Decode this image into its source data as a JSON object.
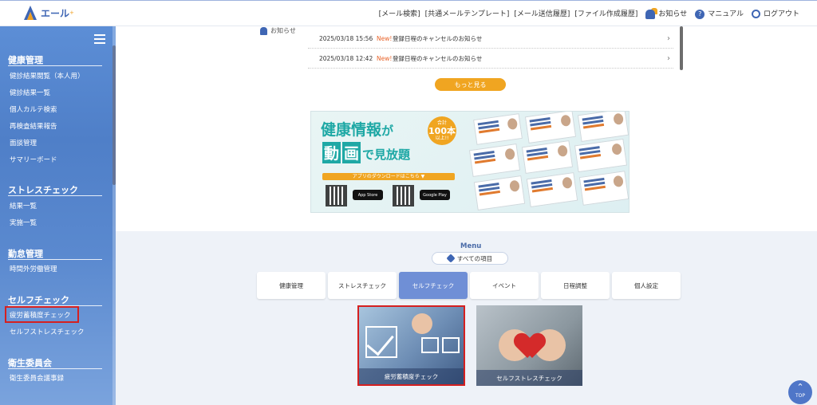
{
  "header": {
    "app_name": "エール",
    "app_sup": "+",
    "nav": [
      "[メール検索]",
      "[共通メールテンプレート]",
      "[メール送信履歴]",
      "[ファイル作成履歴]"
    ],
    "notice": "お知らせ",
    "manual": "マニュアル",
    "logout": "ログアウト"
  },
  "sidebar": {
    "sections": [
      {
        "title": "健康管理",
        "items": [
          "健診結果閲覧（本人用）",
          "健診結果一覧",
          "個人カルテ検索",
          "再検査結果報告",
          "面談管理",
          "サマリーボード"
        ]
      },
      {
        "title": "ストレスチェック",
        "items": [
          "結果一覧",
          "実施一覧"
        ]
      },
      {
        "title": "勤怠管理",
        "items": [
          "時間外労働管理"
        ]
      },
      {
        "title": "セルフチェック",
        "items": [
          "疲労蓄積度チェック",
          "セルフストレスチェック"
        ]
      },
      {
        "title": "衛生委員会",
        "items": [
          "衛生委員会議事録"
        ]
      }
    ]
  },
  "notices": {
    "label": "お知らせ",
    "rows": [
      {
        "date": "2025/03/18 15:56",
        "new": "New!",
        "title": "登録日程のキャンセルのお知らせ"
      },
      {
        "date": "2025/03/18 12:42",
        "new": "New!",
        "title": "登録日程のキャンセルのお知らせ"
      }
    ],
    "more": "もっと見る"
  },
  "banner": {
    "line1": "健康情報",
    "line1_ga": "が",
    "line2_a": "動",
    "line2_b": "画",
    "line2_c": "で見放題",
    "badge_top": "合計",
    "badge_num": "100本",
    "badge_bottom": "以上!!",
    "download": "アプリのダウンロードはこちら ▼",
    "app_store": "App Store",
    "google_play": "Google Play"
  },
  "menu": {
    "title": "Menu",
    "all_items": "すべての項目",
    "tabs": [
      "健康管理",
      "ストレスチェック",
      "セルフチェック",
      "イベント",
      "日程調整",
      "個人設定"
    ],
    "active_tab": "セルフチェック",
    "cards": [
      "疲労蓄積度チェック",
      "セルフストレスチェック"
    ]
  },
  "top_button": "TOP",
  "colors": {
    "accent": "#3f66b4",
    "highlight": "#d52020",
    "button_orange": "#f0a521",
    "tab_active": "#6f8fd6"
  }
}
